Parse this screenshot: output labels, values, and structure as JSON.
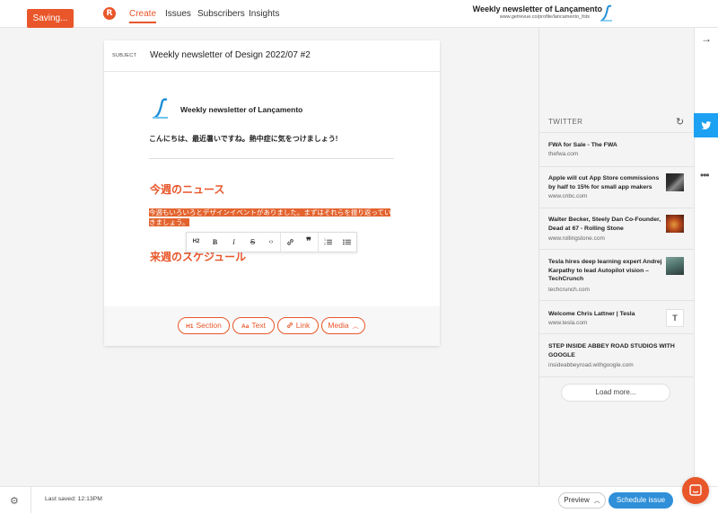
{
  "topbar": {
    "saving_label": "Saving...",
    "logo_glyph": "R",
    "nav": [
      "Create",
      "Issues",
      "Subscribers",
      "Insights"
    ],
    "account_title": "Weekly newsletter of Lançamento",
    "account_url": "www.getrevue.co/profile/lancamento_fots"
  },
  "editor": {
    "subject_label": "SUBJECT",
    "subject_value": "Weekly newsletter of Design 2022/07 #2",
    "newsletter_name": "Weekly newsletter of Lançamento",
    "greeting": "こんにちは、最近暑いですね。熱中症に気をつけましょう!",
    "heading_news": "今週のニュース",
    "selected_text": "今週もいろいろとデザインイベントがありました。まずはそれらを振り返っていきましょう。",
    "heading_schedule": "来週のスケジュール"
  },
  "toolbar": {
    "buttons": [
      "H2",
      "B",
      "I",
      "S",
      "‹›",
      "link",
      "❞",
      "ordered-list",
      "bullet-list"
    ]
  },
  "insert": {
    "section_icon": "H1",
    "section": "Section",
    "text_icon": "Aa",
    "text": "Text",
    "link": "Link",
    "media": "Media"
  },
  "sidebar": {
    "heading": "TWITTER",
    "items": [
      {
        "title": "FWA for Sale - The FWA",
        "url": "thefwa.com"
      },
      {
        "title": "Apple will cut App Store commissions by half to 15% for small app makers",
        "url": "www.cnbc.com"
      },
      {
        "title": "Walter Becker, Steely Dan Co-Founder, Dead at 67 - Rolling Stone",
        "url": "www.rollingstone.com"
      },
      {
        "title": "Tesla hires deep learning expert Andrej Karpathy to lead Autopilot vision – TechCrunch",
        "url": "techcrunch.com"
      },
      {
        "title": "Welcome Chris Lattner | Tesla",
        "url": "www.tesla.com"
      },
      {
        "title": "STEP INSIDE ABBEY ROAD STUDIOS WITH GOOGLE",
        "url": "insideabbeyroad.withgoogle.com"
      }
    ],
    "load_more": "Load more..."
  },
  "bottombar": {
    "last_saved": "Last saved: 12:13PM",
    "preview": "Preview",
    "schedule": "Schedule issue"
  },
  "colors": {
    "accent": "#e8562a",
    "twitter": "#1da1f2",
    "primary_button": "#2f8fd8"
  }
}
